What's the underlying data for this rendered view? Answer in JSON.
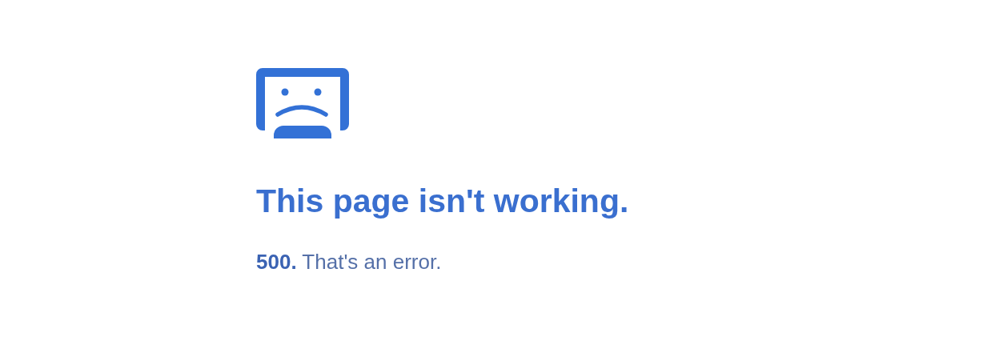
{
  "error": {
    "heading": "This page isn't working.",
    "message": "**500.** That's an error."
  }
}
